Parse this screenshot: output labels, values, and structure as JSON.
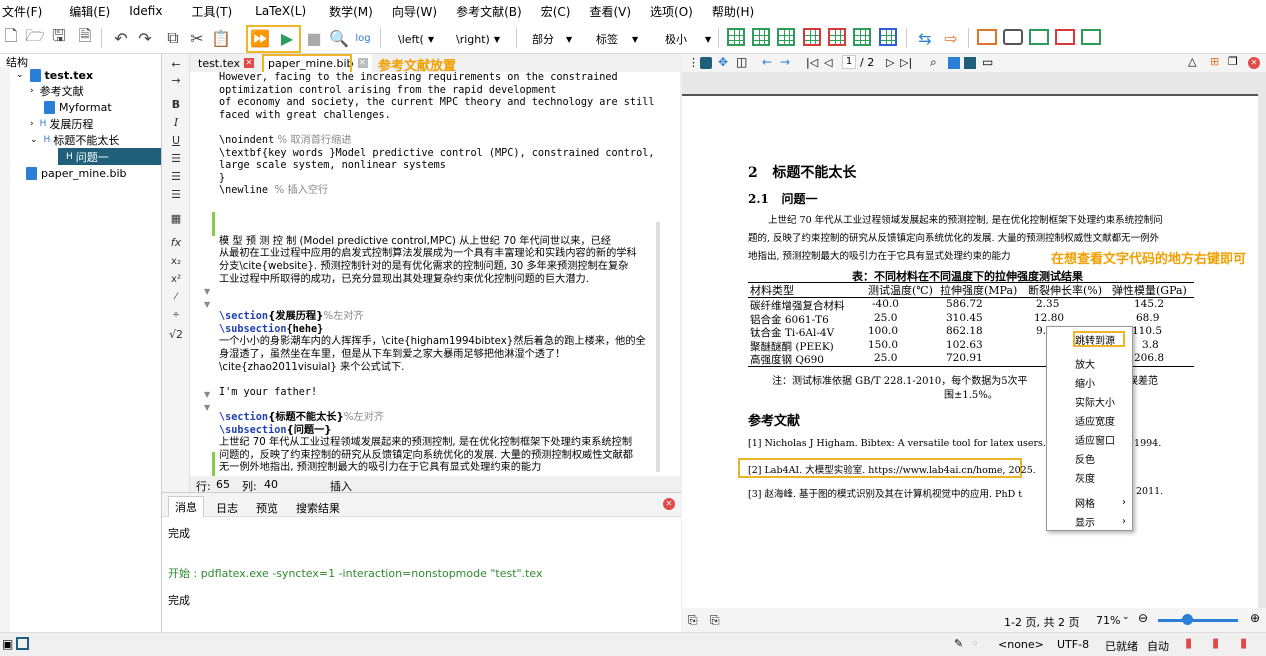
{
  "menu": [
    "文件(F)",
    "编辑(E)",
    "Idefix",
    "工具(T)",
    "LaTeX(L)",
    "数学(M)",
    "向导(W)",
    "参考文献(B)",
    "宏(C)",
    "查看(V)",
    "选项(O)",
    "帮助(H)"
  ],
  "toolbar": {
    "left_label": "\\left(",
    "right_label": "\\right)",
    "part_label": "部分",
    "tag_label": "标签",
    "size_label": "极小"
  },
  "structure": {
    "title": "结构",
    "items": [
      "test.tex",
      "参考文献",
      "Myformat",
      "发展历程",
      "标题不能太长",
      "问题一",
      "paper_mine.bib"
    ]
  },
  "editor": {
    "tabs": [
      "test.tex",
      "paper_mine.bib"
    ],
    "annotation_bib": "参考文献放置",
    "lines": {
      "l1": "However, facing to the increasing requirements on the constrained",
      "l2": "optimization control arising from the rapid development",
      "l3": "of economy and society, the current MPC theory and technology are still",
      "l4": "faced with great challenges.",
      "l5a": "\\noindent",
      "l5b": " % 取消首行缩进",
      "l6": "\\textbf{key words }Model predictive control (MPC), constrained control,",
      "l7": "large scale system, nonlinear systems",
      "l8": "}",
      "l9a": "\\newline",
      "l9b": "  % 插入空行",
      "p1": "模 型 预 测 控 制 (Model predictive control,MPC) 从上世纪 70 年代间世以来，已经",
      "p2": "从最初在工业过程中应用的启发式控制算法发展成为一个具有丰富理论和实践内容的新的学科",
      "p3": "分支\\cite{website}. 预测控制针对的是有优化需求的控制问题, 30 多年来预测控制在复杂",
      "p4": "工业过程中所取得的成功，已充分显现出其处理复杂约束优化控制问题的巨大潜力.",
      "s1a": "\\section",
      "s1b": "{发展历程}",
      "s1c": "%左对齐",
      "s2a": "\\subsection",
      "s2b": "{hehe}",
      "q1": "一个小小的身影潮车内的人挥挥手，\\cite{higham1994bibtex}然后着急的跑上楼来，他的全",
      "q2": "身湿透了，虽然坐在车里，但是从下车到爱之家大暴雨足够把他淋湿个透了！",
      "q3": "\\cite{zhao2011visuial} 来个公式试下.",
      "q4": "I'm your father!",
      "s3a": "\\section",
      "s3b": "{标题不能太长}",
      "s3c": "%左对齐",
      "s4a": "\\subsection",
      "s4b": "{问题一}",
      "r1": "上世纪 70 年代从工业过程领域发展起来的预测控制, 是在优化控制框架下处理约束系统控制",
      "r2": "问题的，反映了约束控制的研究从反馈镇定向系统优化的发展. 大量的预测控制权威性文献都",
      "r3": "无一例外地指出, 预测控制最大的吸引力在于它具有显式处理约束的能力"
    },
    "status_row_label": "行:",
    "status_row": "65",
    "status_col_label": "列:",
    "status_col": "40",
    "status_mode": "插入"
  },
  "messages": {
    "tabs": [
      "消息",
      "日志",
      "预览",
      "搜索结果"
    ],
    "line1": "完成",
    "line2": "开始 : pdflatex.exe -synctex=1 -interaction=nonstopmode \"test\".tex",
    "line3": "完成"
  },
  "pdf": {
    "page_input": "1",
    "page_total": "/ 2",
    "section_num": "2",
    "section_title": "标题不能太长",
    "subsection_num": "2.1",
    "subsection_title": "问题一",
    "para1": "上世纪 70 年代从工业过程领域发展起来的预测控制, 是在优化控制框架下处理约束系统控制问",
    "para2": "题的, 反映了约束控制的研究从反馈镇定向系统优化的发展. 大量的预测控制权威性文献都无一例外",
    "para3": "地指出, 预测控制最大的吸引力在于它具有显式处理约束的能力",
    "annotation_right": "在想查看文字代码的地方右键即可",
    "table_caption": "表：不同材料在不同温度下的拉伸强度测试结果",
    "table_headers": [
      "材料类型",
      "测试温度(℃)",
      "拉伸强度(MPa)",
      "断裂伸长率(%)",
      "弹性模量(GPa)"
    ],
    "table_rows": [
      [
        "碳纤维增强复合材料",
        "-40.0",
        "586.72",
        "2.35",
        "145.2"
      ],
      [
        "铝合金 6061-T6",
        "25.0",
        "310.45",
        "12.80",
        "68.9"
      ],
      [
        "钛合金 Ti-6Al-4V",
        "100.0",
        "862.18",
        "9.42",
        "110.5"
      ],
      [
        "聚醚醚酮 (PEEK)",
        "150.0",
        "102.63",
        "",
        "3.8"
      ],
      [
        "高强度钢 Q690",
        "25.0",
        "720.91",
        "",
        "206.8"
      ]
    ],
    "table_note1": "注：测试标准依据 GB/T 228.1-2010，每个数据为5次平",
    "table_note1b": "误差范",
    "table_note2": "围±1.5%。",
    "refs_title": "参考文献",
    "ref1": "[1] Nicholas J Higham. Bibtex: A versatile tool for latex users. S",
    "ref1b": ", 1994.",
    "ref2": "[2] Lab4AI. 大模型实验室. https://www.lab4ai.cn/home, 2025.",
    "ref3": "[3] 赵海峰. 基于图的模式识别及其在计算机视觉中的应用. PhD t",
    "ref3b": "2011.",
    "status_pages": "1-2 页, 共 2 页",
    "zoom": "71%"
  },
  "context_menu": [
    "跳转到源",
    "放大",
    "缩小",
    "实际大小",
    "适应宽度",
    "适应窗口",
    "反色",
    "灰度",
    "网格",
    "显示"
  ],
  "bottom": {
    "encoding_none": "<none>",
    "encoding": "UTF-8",
    "ready": "已就绪",
    "auto": "自动"
  }
}
